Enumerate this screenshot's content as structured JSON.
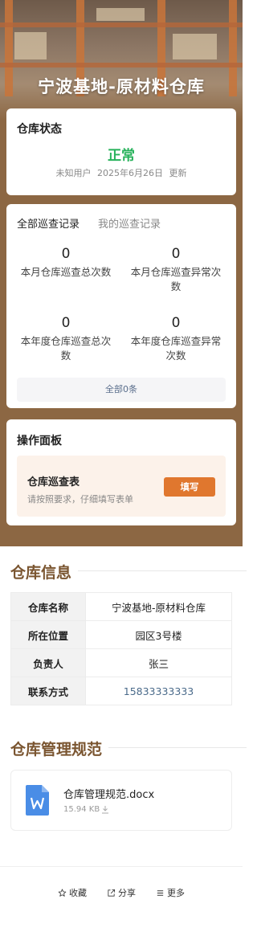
{
  "header": {
    "title": "宁波基地-原材料仓库"
  },
  "status": {
    "title": "仓库状态",
    "value": "正常",
    "user": "未知用户",
    "date": "2025年6月26日",
    "update_label": "更新",
    "value_color": "#27b25b"
  },
  "records": {
    "tabs": [
      "全部巡查记录",
      "我的巡查记录"
    ],
    "stats": [
      {
        "value": "0",
        "label": "本月仓库巡查总次数"
      },
      {
        "value": "0",
        "label": "本月仓库巡查异常次数"
      },
      {
        "value": "0",
        "label": "本年度仓库巡查总次数"
      },
      {
        "value": "0",
        "label": "本年度仓库巡查异常次数"
      }
    ],
    "all_link": "全部0条"
  },
  "operations": {
    "title": "操作面板",
    "form_title": "仓库巡查表",
    "form_desc": "请按照要求，仔细填写表单",
    "fill_label": "填写",
    "accent": "#e0772e"
  },
  "info": {
    "title": "仓库信息",
    "rows": [
      {
        "key": "仓库名称",
        "value": "宁波基地-原材料仓库"
      },
      {
        "key": "所在位置",
        "value": "园区3号楼"
      },
      {
        "key": "负责人",
        "value": "张三"
      },
      {
        "key": "联系方式",
        "value": "15833333333"
      }
    ]
  },
  "rules": {
    "title": "仓库管理规范",
    "file_name": "仓库管理规范.docx",
    "file_size": "15.94 KB",
    "file_icon": "word-doc-icon"
  },
  "bottom_bar": {
    "favorite": "收藏",
    "share": "分享",
    "more": "更多"
  }
}
